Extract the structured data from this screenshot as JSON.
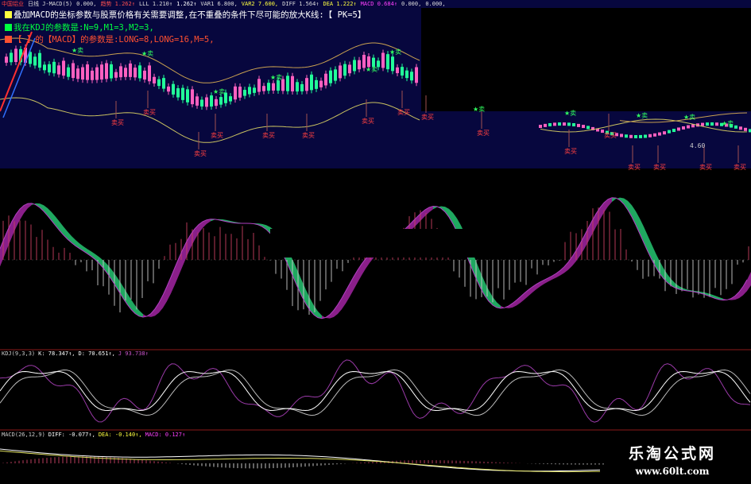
{
  "header_values": [
    {
      "label": "中国铝业",
      "color": "#ff4040"
    },
    {
      "label": "日线 J-MACD(5)",
      "color": "#dddddd"
    },
    {
      "label": "0.000,",
      "color": "#dddddd"
    },
    {
      "label": "趋势 1.262↑",
      "color": "#ff5050"
    },
    {
      "label": "LLL 1.210↑",
      "color": "#dddddd"
    },
    {
      "label": "1.262↑",
      "color": "#ffffff"
    },
    {
      "label": "VAR1 6.800,",
      "color": "#dddddd"
    },
    {
      "label": "VAR2 7.600,",
      "color": "#ffff40"
    },
    {
      "label": "DIFF 1.564↑",
      "color": "#dddddd"
    },
    {
      "label": "DEA 1.222↑",
      "color": "#ffff40"
    },
    {
      "label": "MACD 0.684↑",
      "color": "#ff40ff"
    },
    {
      "label": "0.000,",
      "color": "#dddddd"
    },
    {
      "label": "0.000,",
      "color": "#dddddd"
    }
  ],
  "legend": [
    {
      "text": "叠加MACD的坐标参数与股票价格有关需要调整,在不重叠的条件下尽可能的放大K线:【 PK=5】",
      "color": "#ffffff",
      "square": "#ffff40"
    },
    {
      "text": "我在KDJ的参数是:N=9,M1=3,M2=3,",
      "color": "#00ff40",
      "square": "#00ff40"
    },
    {
      "text": "【 】的【MACD】的参数是:LONG=8,LONG=16,M=5,",
      "color": "#ff5030",
      "square": "#ff5030"
    }
  ],
  "signals": {
    "buy": "★卖",
    "sell": "卖买"
  },
  "price_label": "4.60",
  "kdj_header": [
    {
      "label": "KDJ(9,3,3)",
      "color": "#cccccc"
    },
    {
      "label": "K: 78.347↑,",
      "color": "#ffffff"
    },
    {
      "label": "D: 70.651↑,",
      "color": "#ffffff"
    },
    {
      "label": "J 93.738↑",
      "color": "#cc55cc"
    }
  ],
  "macd_header": [
    {
      "label": "MACD(26,12,9)",
      "color": "#cccccc"
    },
    {
      "label": "DIFF: -0.077↑,",
      "color": "#ffffff"
    },
    {
      "label": "DEA: -0.140↑,",
      "color": "#ffff40"
    },
    {
      "label": "MACD: 0.127↑",
      "color": "#ff40ff"
    }
  ],
  "brand": {
    "name": "乐淘公式网",
    "url": "www.60lt.com"
  },
  "colors": {
    "up": "#ff4040",
    "down": "#00ff88",
    "candle_up": "#ff60c0",
    "ribbon_up": "#8a1f8a",
    "ribbon_down": "#1fa860",
    "hist": "#cccccc",
    "divider": "#8b1a1a"
  }
}
